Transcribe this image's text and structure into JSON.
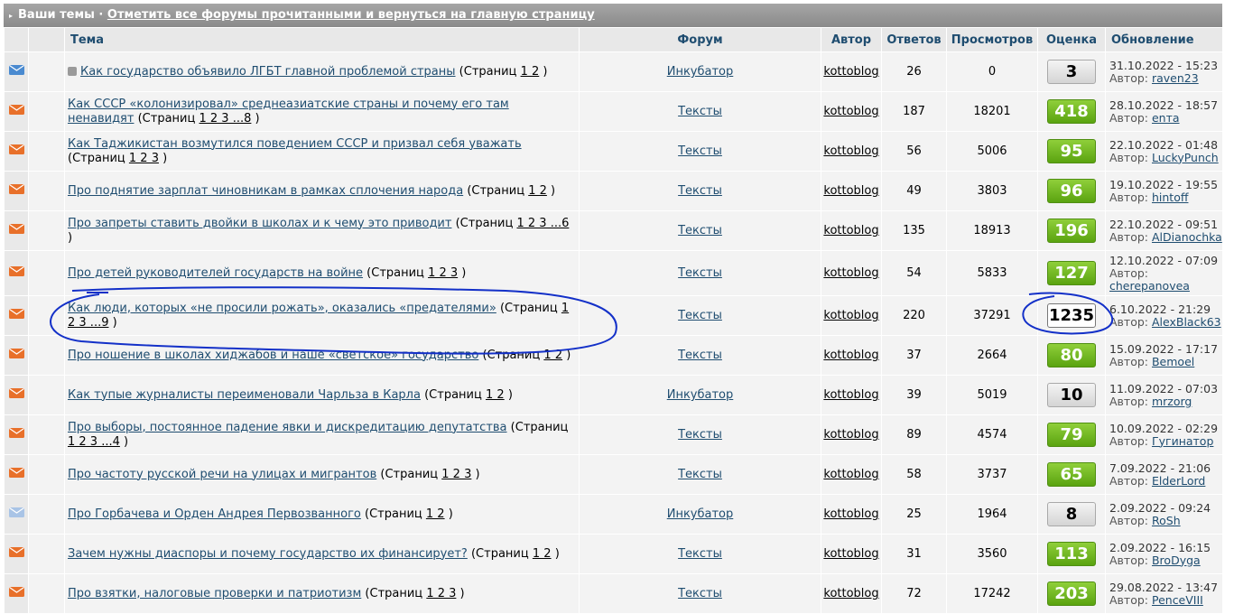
{
  "header": {
    "title": "Ваши темы",
    "mark_read_link": "Отметить все форумы прочитанными и вернуться на главную страницу",
    "separator": "·"
  },
  "columns": {
    "topic": "Тема",
    "forum": "Форум",
    "author": "Автор",
    "replies": "Ответов",
    "views": "Просмотров",
    "rating": "Оценка",
    "updated": "Обновление"
  },
  "labels": {
    "pages_prefix": "(Страниц",
    "pages_suffix": ")",
    "author_prefix": "Автор:"
  },
  "rows": [
    {
      "icon": "envelope-blue",
      "prefix_icon": true,
      "title": "Как государство объявило ЛГБТ главной проблемой страны",
      "pages": "1 2",
      "forum": "Инкубатор",
      "author": "kottoblog",
      "replies": "26",
      "views": "0",
      "rating": "3",
      "rating_style": "gray",
      "date": "31.10.2022 - 15:23",
      "last_author": "raven23"
    },
    {
      "icon": "envelope-orange",
      "title": "Как СССР «колонизировал» среднеазиатские страны и почему его там ненавидят",
      "pages": "1 2 3 ...8",
      "forum": "Тексты",
      "author": "kottoblog",
      "replies": "187",
      "views": "18201",
      "rating": "418",
      "rating_style": "green",
      "date": "28.10.2022 - 18:57",
      "last_author": "enта"
    },
    {
      "icon": "envelope-orange",
      "title": "Как Таджикистан возмутился поведением СССР и призвал себя уважать",
      "pages": "1 2 3",
      "forum": "Тексты",
      "author": "kottoblog",
      "replies": "56",
      "views": "5006",
      "rating": "95",
      "rating_style": "green",
      "date": "22.10.2022 - 01:48",
      "last_author": "LuckyPunch"
    },
    {
      "icon": "envelope-orange",
      "title": "Про поднятие зарплат чиновникам в рамках сплочения народа",
      "pages": "1 2",
      "forum": "Тексты",
      "author": "kottoblog",
      "replies": "49",
      "views": "3803",
      "rating": "96",
      "rating_style": "green",
      "date": "19.10.2022 - 19:55",
      "last_author": "hintoff"
    },
    {
      "icon": "envelope-orange",
      "title": "Про запреты ставить двойки в школах и к чему это приводит",
      "pages": "1 2 3 ...6",
      "forum": "Тексты",
      "author": "kottoblog",
      "replies": "135",
      "views": "18913",
      "rating": "196",
      "rating_style": "green",
      "date": "22.10.2022 - 09:51",
      "last_author": "AlDianochka"
    },
    {
      "icon": "envelope-orange",
      "title": "Про детей руководителей государств на войне",
      "pages": "1 2 3",
      "forum": "Тексты",
      "author": "kottoblog",
      "replies": "54",
      "views": "5833",
      "rating": "127",
      "rating_style": "green",
      "date": "12.10.2022 - 07:09",
      "last_author": "cherepanovea"
    },
    {
      "icon": "envelope-orange",
      "title": "Как люди, которых «не просили рожать», оказались «предателями»",
      "pages": "1 2 3 ...9",
      "forum": "Тексты",
      "author": "kottoblog",
      "replies": "220",
      "views": "37291",
      "rating": "1235",
      "rating_style": "white",
      "date": "6.10.2022 - 21:29",
      "last_author": "AlexBlack63"
    },
    {
      "icon": "envelope-orange",
      "title": "Про ношение в школах хиджабов и наше «светское» государство",
      "pages": "1 2",
      "forum": "Тексты",
      "author": "kottoblog",
      "replies": "37",
      "views": "2664",
      "rating": "80",
      "rating_style": "green",
      "date": "15.09.2022 - 17:17",
      "last_author": "Bemoel"
    },
    {
      "icon": "envelope-orange",
      "title": "Как тупые журналисты переименовали Чарльза в Карла",
      "pages": "1 2",
      "forum": "Инкубатор",
      "author": "kottoblog",
      "replies": "39",
      "views": "5019",
      "rating": "10",
      "rating_style": "gray",
      "date": "11.09.2022 - 07:03",
      "last_author": "mrzorg"
    },
    {
      "icon": "envelope-orange",
      "title": "Про выборы, постоянное падение явки и дискредитацию депутатства",
      "pages": "1 2 3 ...4",
      "forum": "Тексты",
      "author": "kottoblog",
      "replies": "89",
      "views": "4574",
      "rating": "79",
      "rating_style": "green",
      "date": "10.09.2022 - 02:29",
      "last_author": "Гугинатор"
    },
    {
      "icon": "envelope-orange",
      "title": "Про частоту русской речи на улицах и мигрантов",
      "pages": "1 2 3",
      "forum": "Тексты",
      "author": "kottoblog",
      "replies": "58",
      "views": "3737",
      "rating": "65",
      "rating_style": "green",
      "date": "7.09.2022 - 21:06",
      "last_author": "ElderLord"
    },
    {
      "icon": "envelope-light",
      "title": "Про Горбачева и Орден Андрея Первозванного",
      "pages": "1 2",
      "forum": "Инкубатор",
      "author": "kottoblog",
      "replies": "25",
      "views": "1964",
      "rating": "8",
      "rating_style": "gray",
      "date": "2.09.2022 - 09:24",
      "last_author": "RoSh"
    },
    {
      "icon": "envelope-orange",
      "title": "Зачем нужны диаспоры и почему государство их финансирует?",
      "pages": "1 2",
      "forum": "Тексты",
      "author": "kottoblog",
      "replies": "31",
      "views": "3560",
      "rating": "113",
      "rating_style": "green",
      "date": "2.09.2022 - 16:15",
      "last_author": "BroDyga"
    },
    {
      "icon": "envelope-orange",
      "title": "Про взятки, налоговые проверки и патриотизм",
      "pages": "1 2 3",
      "forum": "Тексты",
      "author": "kottoblog",
      "replies": "72",
      "views": "17242",
      "rating": "203",
      "rating_style": "green",
      "date": "29.08.2022 - 13:47",
      "last_author": "PenceVIII"
    }
  ],
  "colors": {
    "envelope_orange": "#e8702a",
    "envelope_blue": "#4a8ad0",
    "envelope_light": "#a9c4e6",
    "annotation": "#1330c8"
  }
}
